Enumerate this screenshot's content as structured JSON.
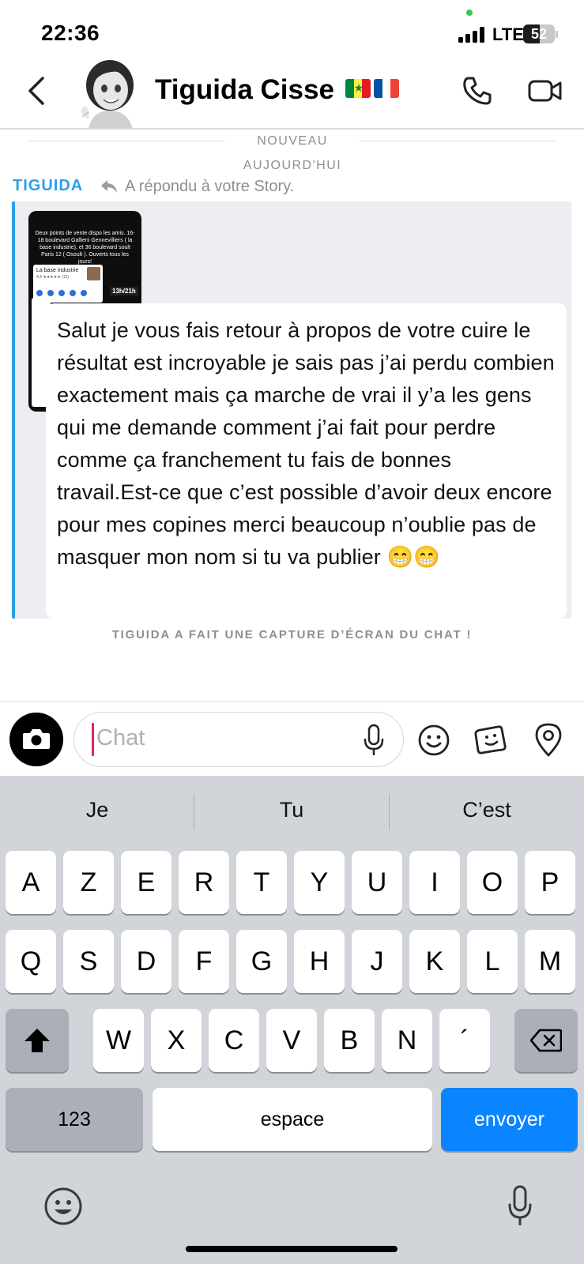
{
  "status_bar": {
    "time": "22:36",
    "network": "LTE",
    "battery": "52",
    "battery_level": 0.52
  },
  "header": {
    "contact_name": "Tiguida Cisse",
    "flags": [
      "senegal-flag",
      "france-flag"
    ],
    "icons": [
      "back-icon",
      "phone-icon",
      "video-icon"
    ]
  },
  "chat": {
    "new_label": "NOUVEAU",
    "today_label": "AUJOURD'HUI",
    "sender": "TIGUIDA",
    "reply_note": "A répondu à votre Story.",
    "story": {
      "text": "Deux points de vente dispo les amis. 16-18 boulevard Gallieni Gennevilliers ( la base industrie), et 36 boulevard soult Paris 12 ( Osoult ). Ouverts tous les jours!",
      "card_title": "La base industrie",
      "card_subtitle": "4,4 ★★★★★ (12)",
      "time": "13h/21h"
    },
    "message": "Salut je vous fais retour à propos de votre cuire le résultat est incroyable je sais pas j’ai perdu combien exactement mais ça marche de vrai il y’a les gens qui me demande comment j’ai fait pour perdre comme ça franchement tu fais de bonnes travail.Est-ce que c’est possible d’avoir deux encore pour mes copines merci beaucoup n’oublie pas de masquer mon nom si tu va publier 😁😁",
    "screenshot_note": "TIGUIDA A FAIT UNE CAPTURE D’ÉCRAN DU CHAT !"
  },
  "composer": {
    "placeholder": "Chat",
    "icons": [
      "camera-icon",
      "microphone-icon",
      "emoji-icon",
      "sticker-icon",
      "location-icon"
    ]
  },
  "keyboard": {
    "suggestions": [
      "Je",
      "Tu",
      "C’est"
    ],
    "row1": [
      "A",
      "Z",
      "E",
      "R",
      "T",
      "Y",
      "U",
      "I",
      "O",
      "P"
    ],
    "row2": [
      "Q",
      "S",
      "D",
      "F",
      "G",
      "H",
      "J",
      "K",
      "L",
      "M"
    ],
    "row3": [
      "W",
      "X",
      "C",
      "V",
      "B",
      "N",
      "´"
    ],
    "numbers_label": "123",
    "space_label": "espace",
    "send_label": "envoyer",
    "accent_color": "#0a84ff"
  }
}
